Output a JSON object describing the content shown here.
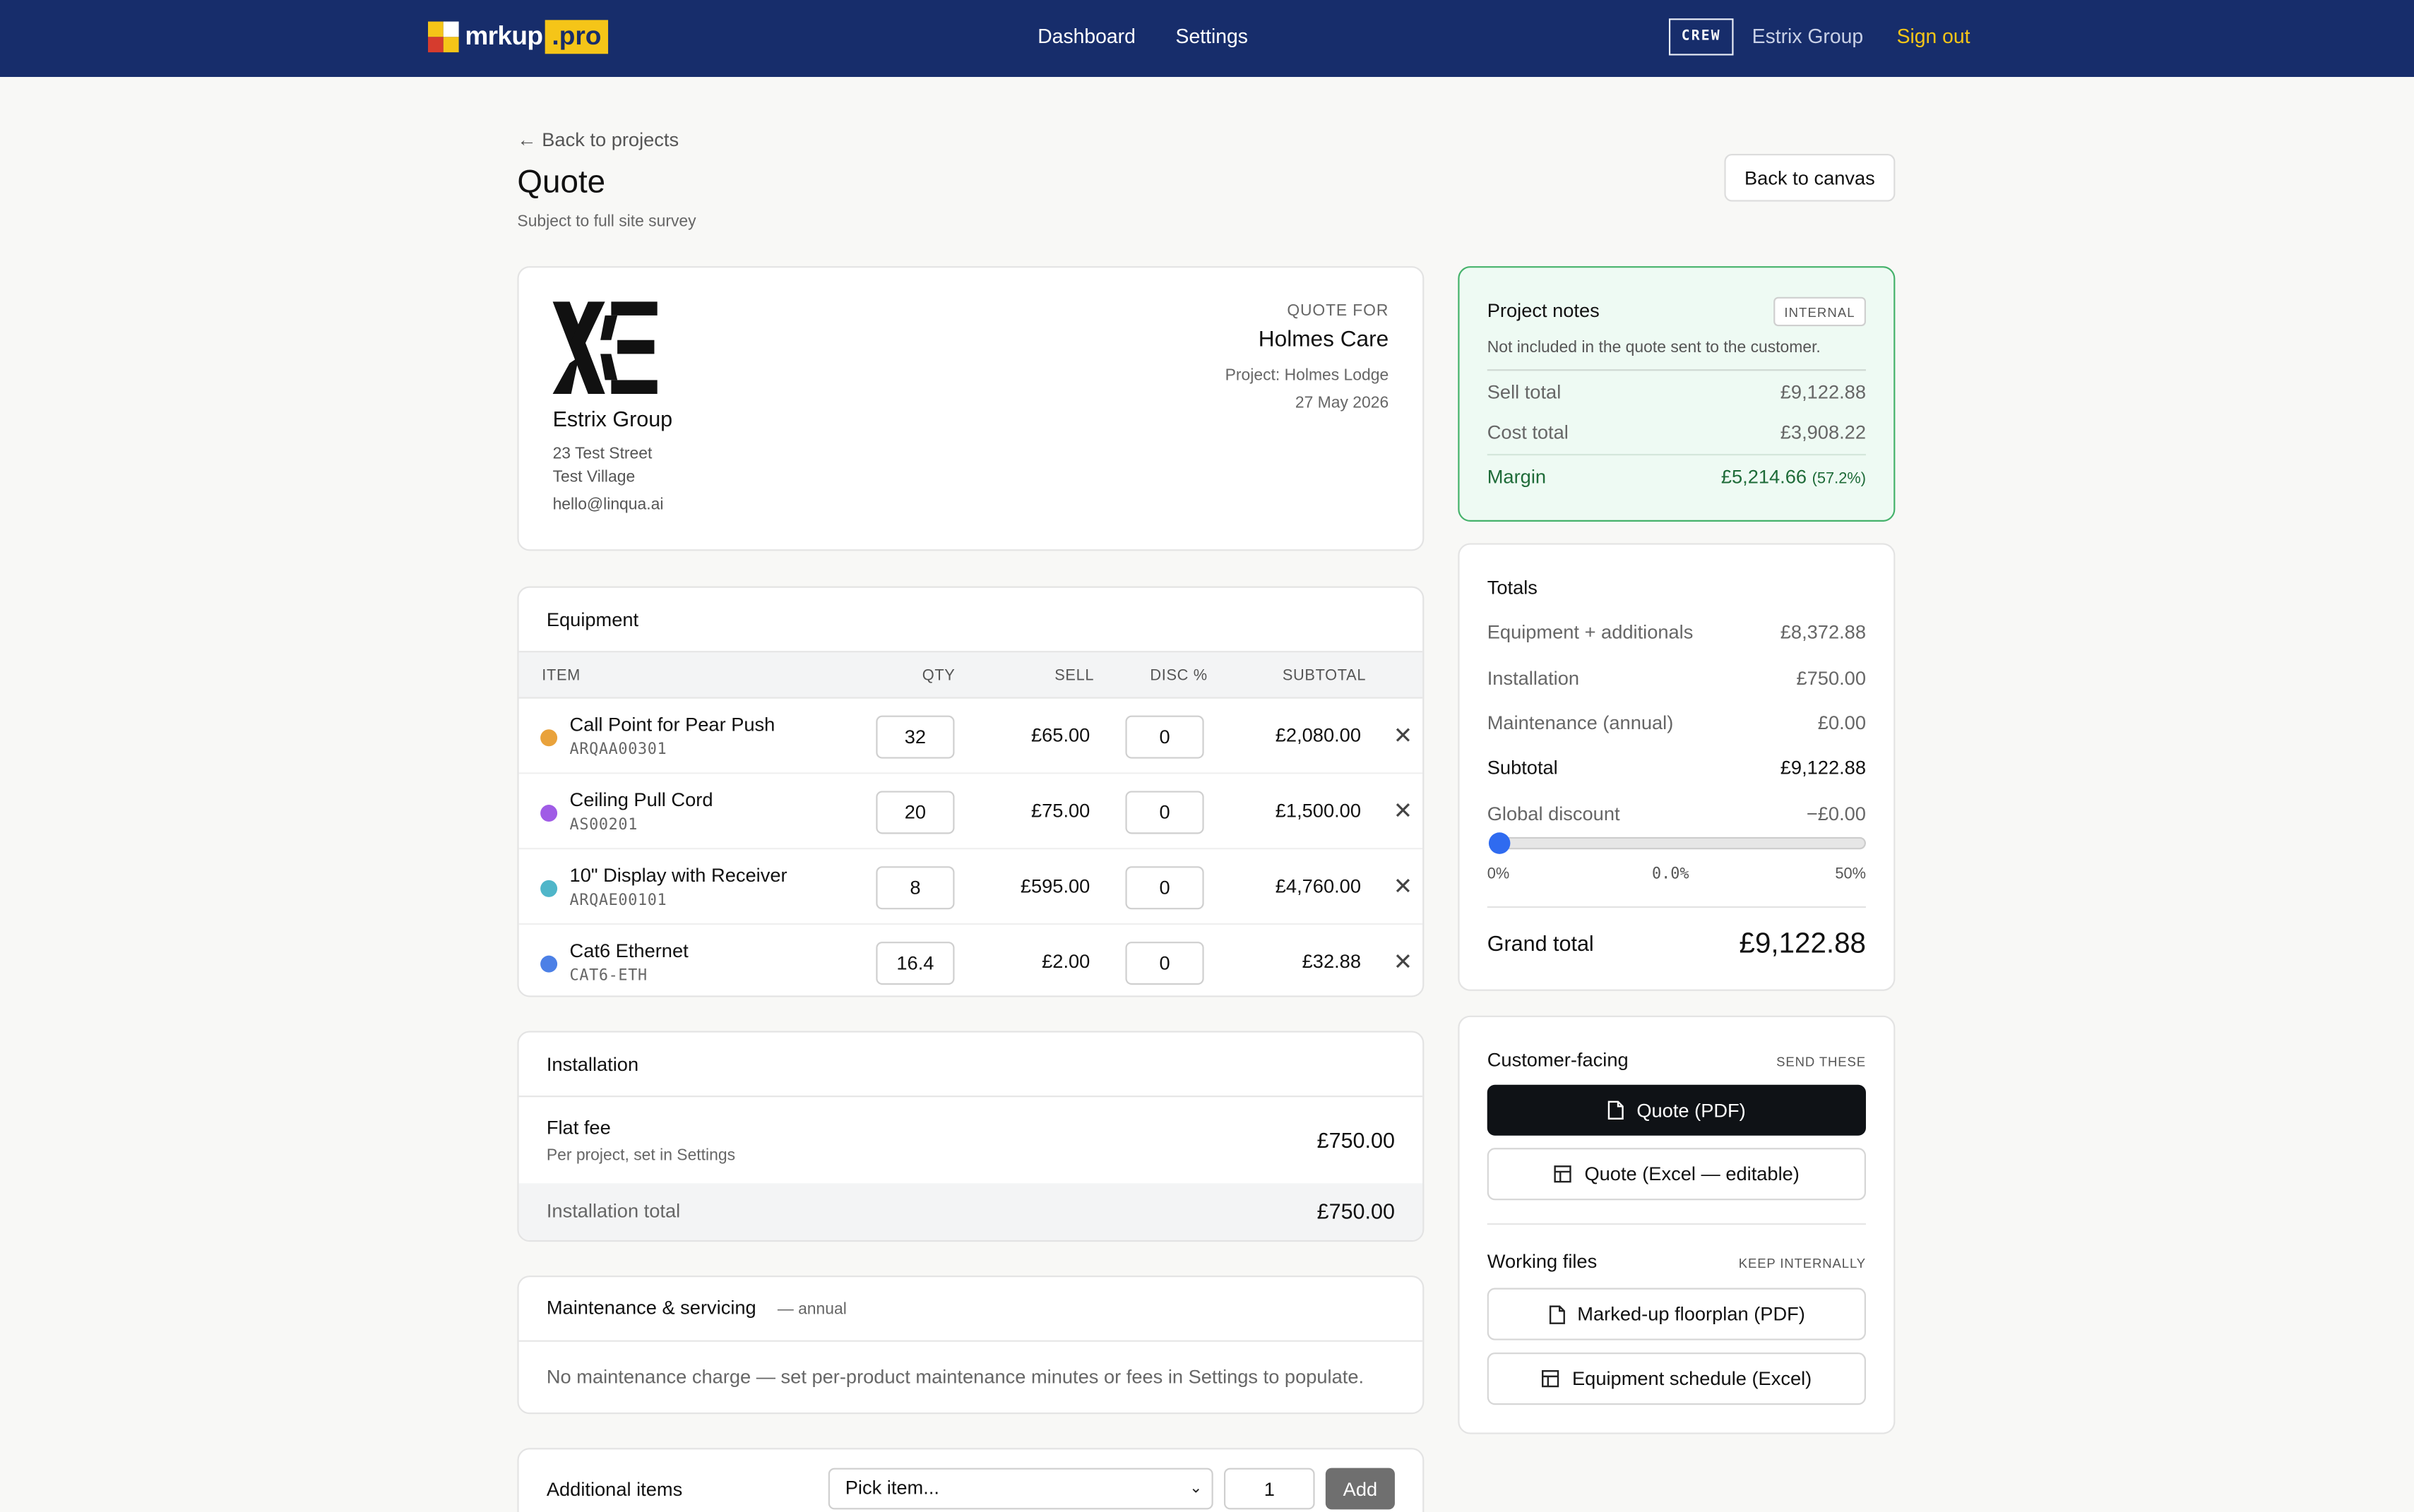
{
  "app": {
    "brand_name": "mrkup",
    "brand_suffix": ".pro",
    "nav": [
      "Dashboard",
      "Settings"
    ],
    "role_badge": "CREW",
    "org_name": "Estrix Group",
    "sign_out": "Sign out"
  },
  "header": {
    "back_link": "← Back to projects",
    "title": "Quote",
    "subtitle": "Subject to full site survey",
    "back_canvas": "Back to canvas"
  },
  "company": {
    "name": "Estrix Group",
    "address_line1": "23 Test Street",
    "address_line2": "Test Village",
    "email": "hello@linqua.ai"
  },
  "quote_for": {
    "label": "QUOTE FOR",
    "customer": "Holmes Care",
    "project": "Project: Holmes Lodge",
    "date": "27 May 2026"
  },
  "equipment": {
    "title": "Equipment",
    "columns": {
      "item": "ITEM",
      "qty": "QTY",
      "sell": "SELL",
      "disc": "DISC %",
      "subtotal": "SUBTOTAL"
    },
    "rows": [
      {
        "name": "Call Point for Pear Push",
        "sku": "ARQAA00301",
        "qty": "32",
        "sell": "£65.00",
        "disc": "0",
        "subtotal": "£2,080.00",
        "color": "#e9a23b"
      },
      {
        "name": "Ceiling Pull Cord",
        "sku": "AS00201",
        "qty": "20",
        "sell": "£75.00",
        "disc": "0",
        "subtotal": "£1,500.00",
        "color": "#a05ce6"
      },
      {
        "name": "10\" Display with Receiver",
        "sku": "ARQAE00101",
        "qty": "8",
        "sell": "£595.00",
        "disc": "0",
        "subtotal": "£4,760.00",
        "color": "#4fb6c9"
      },
      {
        "name": "Cat6 Ethernet",
        "sku": "CAT6-ETH",
        "qty": "16.4",
        "sell": "£2.00",
        "disc": "0",
        "subtotal": "£32.88",
        "color": "#4c80e6"
      }
    ]
  },
  "installation": {
    "title": "Installation",
    "fee_label": "Flat fee",
    "fee_note": "Per project, set in Settings",
    "fee_value": "£750.00",
    "total_label": "Installation total",
    "total_value": "£750.00"
  },
  "maintenance": {
    "title": "Maintenance & servicing",
    "qualifier": "— annual",
    "empty_message": "No maintenance charge — set per-product maintenance minutes or fees in Settings to populate."
  },
  "additional": {
    "title": "Additional items",
    "select_value": "Pick item...",
    "qty": "1",
    "add_label": "Add"
  },
  "notes": {
    "title": "Project notes",
    "badge": "INTERNAL",
    "note": "Not included in the quote sent to the customer.",
    "sell_label": "Sell total",
    "sell_value": "£9,122.88",
    "cost_label": "Cost total",
    "cost_value": "£3,908.22",
    "margin_label": "Margin",
    "margin_value": "£5,214.66",
    "margin_pct": "(57.2%)"
  },
  "totals": {
    "title": "Totals",
    "lines": [
      {
        "label": "Equipment + additionals",
        "value": "£8,372.88"
      },
      {
        "label": "Installation",
        "value": "£750.00"
      },
      {
        "label": "Maintenance (annual)",
        "value": "£0.00"
      }
    ],
    "subtotal_label": "Subtotal",
    "subtotal_value": "£9,122.88",
    "discount_label": "Global discount",
    "discount_value": "−£0.00",
    "discount_fraction": 0.0,
    "slider_min": "0%",
    "slider_current": "0.0%",
    "slider_max": "50%",
    "grand_label": "Grand total",
    "grand_value": "£9,122.88"
  },
  "files": {
    "customer_title": "Customer-facing",
    "customer_hint": "SEND THESE",
    "quote_pdf": "Quote (PDF)",
    "quote_excel": "Quote (Excel — editable)",
    "working_title": "Working files",
    "working_hint": "KEEP INTERNALLY",
    "floorplan_pdf": "Marked-up floorplan (PDF)",
    "schedule_excel": "Equipment schedule (Excel)"
  }
}
